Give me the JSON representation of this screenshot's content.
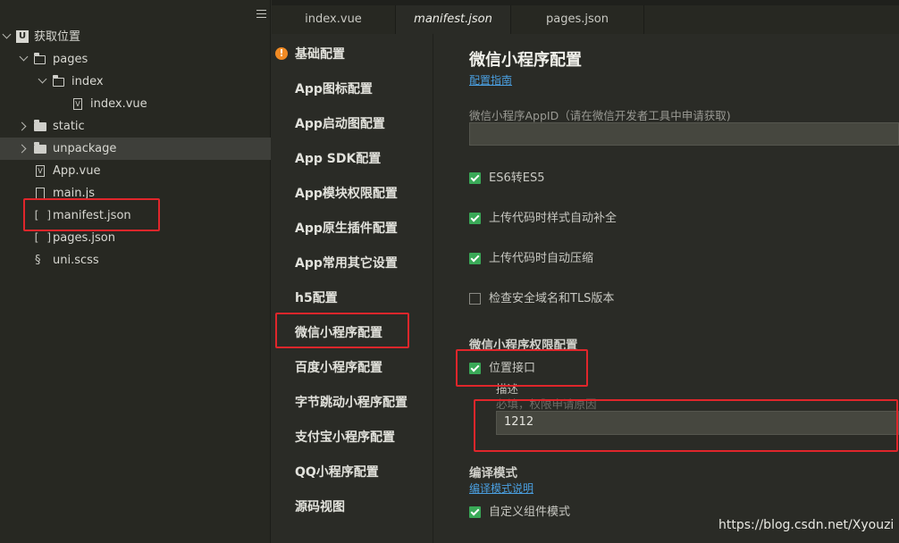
{
  "file_tree": {
    "project": "获取位置",
    "items": [
      {
        "label": "pages",
        "icon": "folder-open-icon"
      },
      {
        "label": "index",
        "icon": "folder-open-icon"
      },
      {
        "label": "index.vue",
        "icon": "vue-file-icon"
      },
      {
        "label": "static",
        "icon": "folder-icon"
      },
      {
        "label": "unpackage",
        "icon": "folder-icon"
      },
      {
        "label": "App.vue",
        "icon": "vue-file-icon"
      },
      {
        "label": "main.js",
        "icon": "js-file-icon"
      },
      {
        "label": "manifest.json",
        "icon": "json-file-icon"
      },
      {
        "label": "pages.json",
        "icon": "json-file-icon"
      },
      {
        "label": "uni.scss",
        "icon": "scss-file-icon"
      }
    ]
  },
  "tabs": [
    {
      "label": "index.vue",
      "active": false
    },
    {
      "label": "manifest.json",
      "active": true
    },
    {
      "label": "pages.json",
      "active": false
    }
  ],
  "nav": [
    "基础配置",
    "App图标配置",
    "App启动图配置",
    "App SDK配置",
    "App模块权限配置",
    "App原生插件配置",
    "App常用其它设置",
    "h5配置",
    "微信小程序配置",
    "百度小程序配置",
    "字节跳动小程序配置",
    "支付宝小程序配置",
    "QQ小程序配置",
    "源码视图"
  ],
  "content": {
    "title": "微信小程序配置",
    "guide_link": "配置指南",
    "appid_label": "微信小程序AppID（请在微信开发者工具中申请获取)",
    "appid_value": "",
    "checkboxes": [
      {
        "label": "ES6转ES5",
        "checked": true
      },
      {
        "label": "上传代码时样式自动补全",
        "checked": true
      },
      {
        "label": "上传代码时自动压缩",
        "checked": true
      },
      {
        "label": "检查安全域名和TLS版本",
        "checked": false
      }
    ],
    "permission_title": "微信小程序权限配置",
    "location_label": "位置接口",
    "location_checked": true,
    "desc_label": "描述",
    "desc_placeholder": "必填，权限申请原因",
    "desc_value": "1212",
    "compile_title": "编译模式",
    "compile_link": "编译模式说明",
    "custom_component_label": "自定义组件模式",
    "custom_component_checked": true
  },
  "watermark": "https://blog.csdn.net/Xyouzi",
  "colors": {
    "highlight": "#e0262b",
    "checkbox": "#39a957",
    "link": "#4a9fe0",
    "warning": "#f08a24"
  }
}
